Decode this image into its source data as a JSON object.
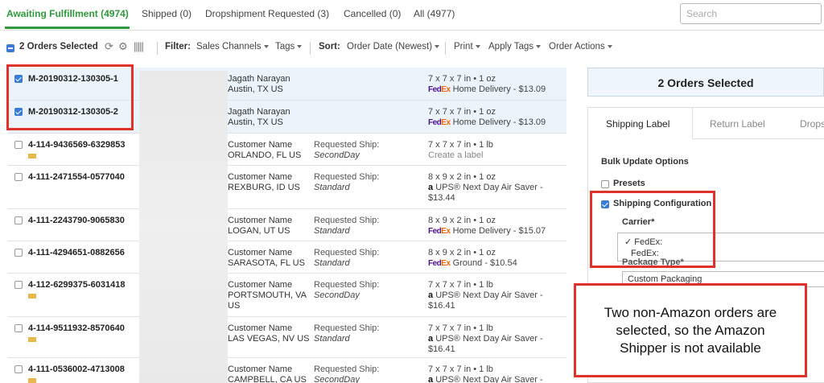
{
  "tabs": [
    {
      "label": "Awaiting Fulfillment (4974)",
      "active": true
    },
    {
      "label": "Shipped (0)"
    },
    {
      "label": "Dropshipment Requested (3)"
    },
    {
      "label": "Cancelled (0)"
    },
    {
      "label": "All (4977)"
    }
  ],
  "search": {
    "placeholder": "Search"
  },
  "toolbar": {
    "selected": "2 Orders Selected",
    "filter_label": "Filter:",
    "sales_channels": "Sales Channels",
    "tags": "Tags",
    "sort_label": "Sort:",
    "sort_value": "Order Date (Newest)",
    "print": "Print",
    "apply_tags": "Apply Tags",
    "order_actions": "Order Actions"
  },
  "orders": [
    {
      "id": "M-20190312-130305-1",
      "name": "Jagath Narayan",
      "loc": "Austin, TX US",
      "req_label": "",
      "req_value": "",
      "dims": "7 x 7 x 7 in",
      "weight": "1 oz",
      "carrier": "fedex",
      "service": "Home Delivery - $13.09",
      "service2": "",
      "selected": true,
      "tag": false
    },
    {
      "id": "M-20190312-130305-2",
      "name": "Jagath Narayan",
      "loc": "Austin, TX US",
      "req_label": "",
      "req_value": "",
      "dims": "7 x 7 x 7 in",
      "weight": "1 oz",
      "carrier": "fedex",
      "service": "Home Delivery - $13.09",
      "service2": "",
      "selected": true,
      "tag": false
    },
    {
      "id": "4-114-9436569-6329853",
      "name": "Customer Name",
      "loc": "ORLANDO, FL US",
      "req_label": "Requested Ship:",
      "req_value": "SecondDay",
      "dims": "7 x 7 x 7 in",
      "weight": "1 lb",
      "carrier": "none",
      "service": "Create a label",
      "service2": "",
      "selected": false,
      "tag": true
    },
    {
      "id": "4-111-2471554-0577040",
      "name": "Customer Name",
      "loc": "REXBURG, ID US",
      "req_label": "Requested Ship:",
      "req_value": "Standard",
      "dims": "8 x 9 x 2 in",
      "weight": "1 oz",
      "carrier": "amazon",
      "service": "UPS® Next Day Air Saver -",
      "service2": "$13.44",
      "selected": false,
      "tag": false
    },
    {
      "id": "4-111-2243790-9065830",
      "name": "Customer Name",
      "loc": "LOGAN, UT US",
      "req_label": "Requested Ship:",
      "req_value": "Standard",
      "dims": "8 x 9 x 2 in",
      "weight": "1 oz",
      "carrier": "fedex",
      "service": "Home Delivery - $15.07",
      "service2": "",
      "selected": false,
      "tag": false
    },
    {
      "id": "4-111-4294651-0882656",
      "name": "Customer Name",
      "loc": "SARASOTA, FL US",
      "req_label": "Requested Ship:",
      "req_value": "Standard",
      "dims": "8 x 9 x 2 in",
      "weight": "1 oz",
      "carrier": "fedex",
      "service": "Ground - $10.54",
      "service2": "",
      "selected": false,
      "tag": false
    },
    {
      "id": "4-112-6299375-6031418",
      "name": "Customer Name",
      "loc": "PORTSMOUTH, VA",
      "loc2": "US",
      "req_label": "Requested Ship:",
      "req_value": "SecondDay",
      "dims": "7 x 7 x 7 in",
      "weight": "1 lb",
      "carrier": "amazon",
      "service": "UPS® Next Day Air Saver -",
      "service2": "$16.41",
      "selected": false,
      "tag": true
    },
    {
      "id": "4-114-9511932-8570640",
      "name": "Customer Name",
      "loc": "LAS VEGAS, NV US",
      "req_label": "Requested Ship:",
      "req_value": "Standard",
      "dims": "7 x 7 x 7 in",
      "weight": "1 lb",
      "carrier": "amazon",
      "service": "UPS® Next Day Air Saver -",
      "service2": "$16.41",
      "selected": false,
      "tag": true
    },
    {
      "id": "4-111-0536002-4713008",
      "name": "Customer Name",
      "loc": "CAMPBELL, CA US",
      "req_label": "Requested Ship:",
      "req_value": "SecondDay",
      "dims": "7 x 7 x 7 in",
      "weight": "1 lb",
      "carrier": "amazon",
      "service": "UPS® Next Day Air Saver -",
      "service2": "",
      "selected": false,
      "tag": true
    }
  ],
  "carrier_text": {
    "fed": "Fed",
    "ex": "Ex",
    "amazon": "a"
  },
  "panel": {
    "title": "2 Orders Selected",
    "tabs": [
      "Shipping Label",
      "Return Label",
      "Drops"
    ],
    "bulk": "Bulk Update Options",
    "presets": "Presets",
    "shipping_config": "Shipping Configuration",
    "carrier_label": "Carrier*",
    "carrier_opt1": "✓ FedEx:",
    "carrier_opt2": "FedEx:",
    "package_label": "Package Type*",
    "package_value": "Custom Packaging"
  },
  "callout": "Two non-Amazon orders are selected, so the Amazon Shipper is not available",
  "colors": {
    "accent": "#2e9a3c",
    "highlight": "#e0322b",
    "fedex_purple": "#4d148c",
    "fedex_orange": "#ff6200"
  }
}
